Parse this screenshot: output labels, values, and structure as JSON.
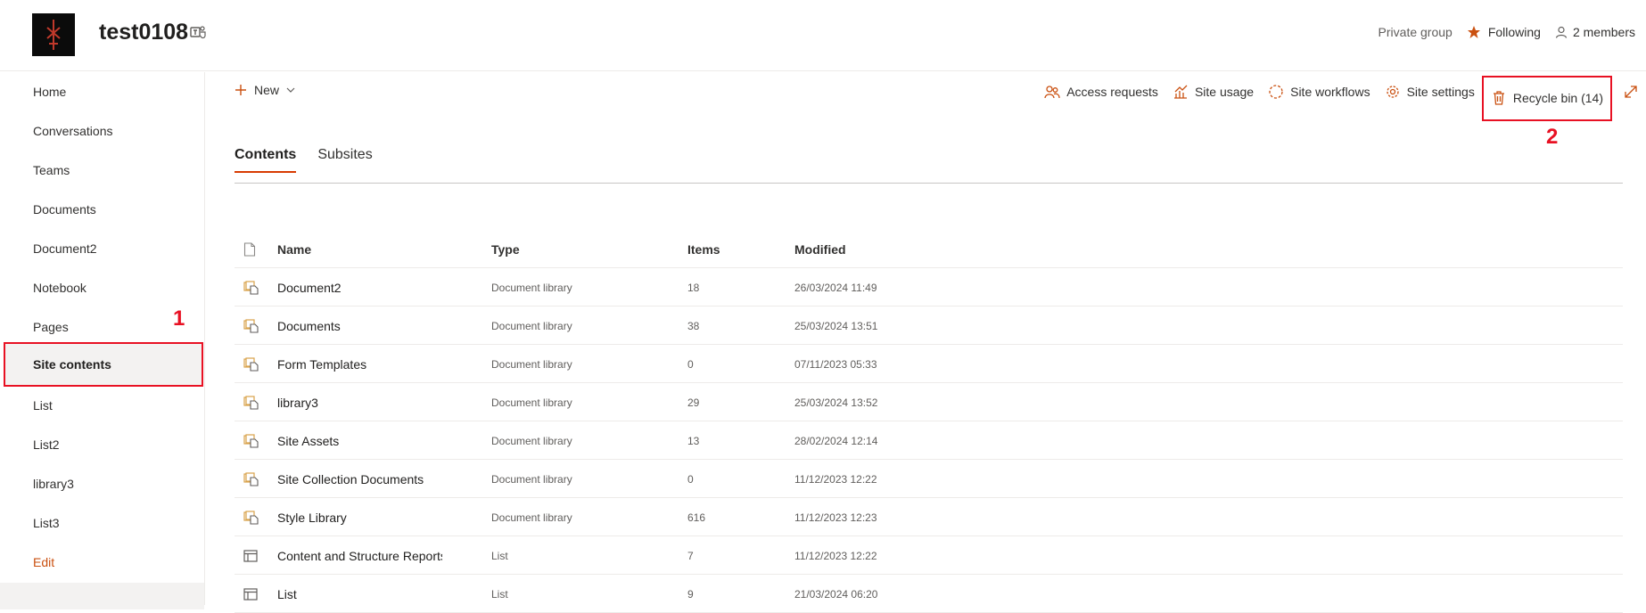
{
  "header": {
    "site_title": "test0108",
    "privacy": "Private group",
    "following": "Following",
    "members": "2 members"
  },
  "leftnav": {
    "items": [
      {
        "label": "Home"
      },
      {
        "label": "Conversations"
      },
      {
        "label": "Teams"
      },
      {
        "label": "Documents"
      },
      {
        "label": "Document2"
      },
      {
        "label": "Notebook"
      },
      {
        "label": "Pages"
      },
      {
        "label": "Site contents",
        "selected": true
      },
      {
        "label": "List"
      },
      {
        "label": "List2"
      },
      {
        "label": "library3"
      },
      {
        "label": "List3"
      }
    ],
    "edit": "Edit"
  },
  "annotations": {
    "one": "1",
    "two": "2"
  },
  "commandbar": {
    "new_label": "New",
    "access_requests": "Access requests",
    "site_usage": "Site usage",
    "site_workflows": "Site workflows",
    "site_settings": "Site settings",
    "recycle_bin": "Recycle bin (14)"
  },
  "tabs": [
    {
      "label": "Contents",
      "active": true
    },
    {
      "label": "Subsites",
      "active": false
    }
  ],
  "table": {
    "headers": {
      "name": "Name",
      "type": "Type",
      "items": "Items",
      "modified": "Modified"
    },
    "rows": [
      {
        "icon": "library-icon",
        "name": "Document2",
        "type": "Document library",
        "items": "18",
        "modified": "26/03/2024 11:49"
      },
      {
        "icon": "library-icon",
        "name": "Documents",
        "type": "Document library",
        "items": "38",
        "modified": "25/03/2024 13:51"
      },
      {
        "icon": "library-icon",
        "name": "Form Templates",
        "type": "Document library",
        "items": "0",
        "modified": "07/11/2023 05:33"
      },
      {
        "icon": "library-icon",
        "name": "library3",
        "type": "Document library",
        "items": "29",
        "modified": "25/03/2024 13:52"
      },
      {
        "icon": "library-icon",
        "name": "Site Assets",
        "type": "Document library",
        "items": "13",
        "modified": "28/02/2024 12:14"
      },
      {
        "icon": "library-icon",
        "name": "Site Collection Documents",
        "type": "Document library",
        "items": "0",
        "modified": "11/12/2023 12:22"
      },
      {
        "icon": "library-icon",
        "name": "Style Library",
        "type": "Document library",
        "items": "616",
        "modified": "11/12/2023 12:23"
      },
      {
        "icon": "list-icon",
        "name": "Content and Structure Reports",
        "type": "List",
        "items": "7",
        "modified": "11/12/2023 12:22"
      },
      {
        "icon": "list-icon",
        "name": "List",
        "type": "List",
        "items": "9",
        "modified": "21/03/2024 06:20"
      }
    ]
  },
  "colors": {
    "accent": "#ca5010",
    "highlight": "#e81123"
  }
}
